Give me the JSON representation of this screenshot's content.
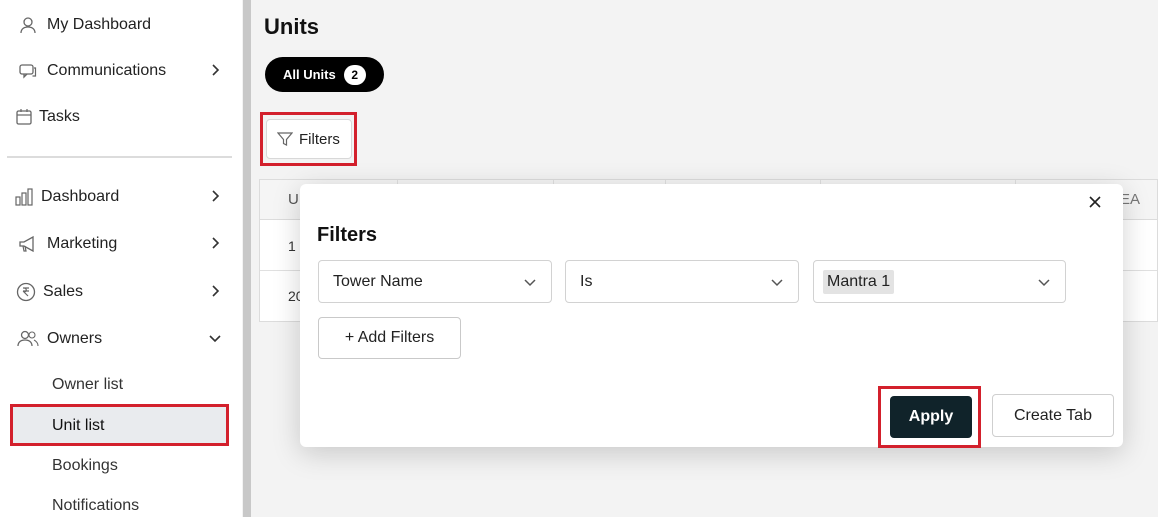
{
  "sidebar": {
    "items": [
      {
        "label": "My Dashboard",
        "icon": "user-icon"
      },
      {
        "label": "Communications",
        "icon": "chat-icon"
      },
      {
        "label": "Tasks",
        "icon": "calendar-icon"
      },
      {
        "label": "Dashboard",
        "icon": "bar-chart-icon"
      },
      {
        "label": "Marketing",
        "icon": "megaphone-icon"
      },
      {
        "label": "Sales",
        "icon": "rupee-icon"
      },
      {
        "label": "Owners",
        "icon": "users-icon"
      }
    ],
    "sub_items": [
      "Owner list",
      "Unit list",
      "Bookings",
      "Notifications"
    ]
  },
  "main": {
    "page_title": "Units",
    "tab": {
      "label": "All Units",
      "count": "2"
    },
    "filters_button": "Filters",
    "table": {
      "header_first": "U",
      "header_last": "EA",
      "rows": [
        "1",
        "20"
      ]
    }
  },
  "popup": {
    "title": "Filters",
    "field_select": "Tower Name",
    "operator_select": "Is",
    "value_select": "Mantra 1",
    "add_filters": "+ Add Filters",
    "apply": "Apply",
    "create_tab": "Create Tab"
  },
  "colors": {
    "highlight": "#d3202c",
    "apply_bg": "#10232a",
    "pill_bg": "#000000"
  }
}
